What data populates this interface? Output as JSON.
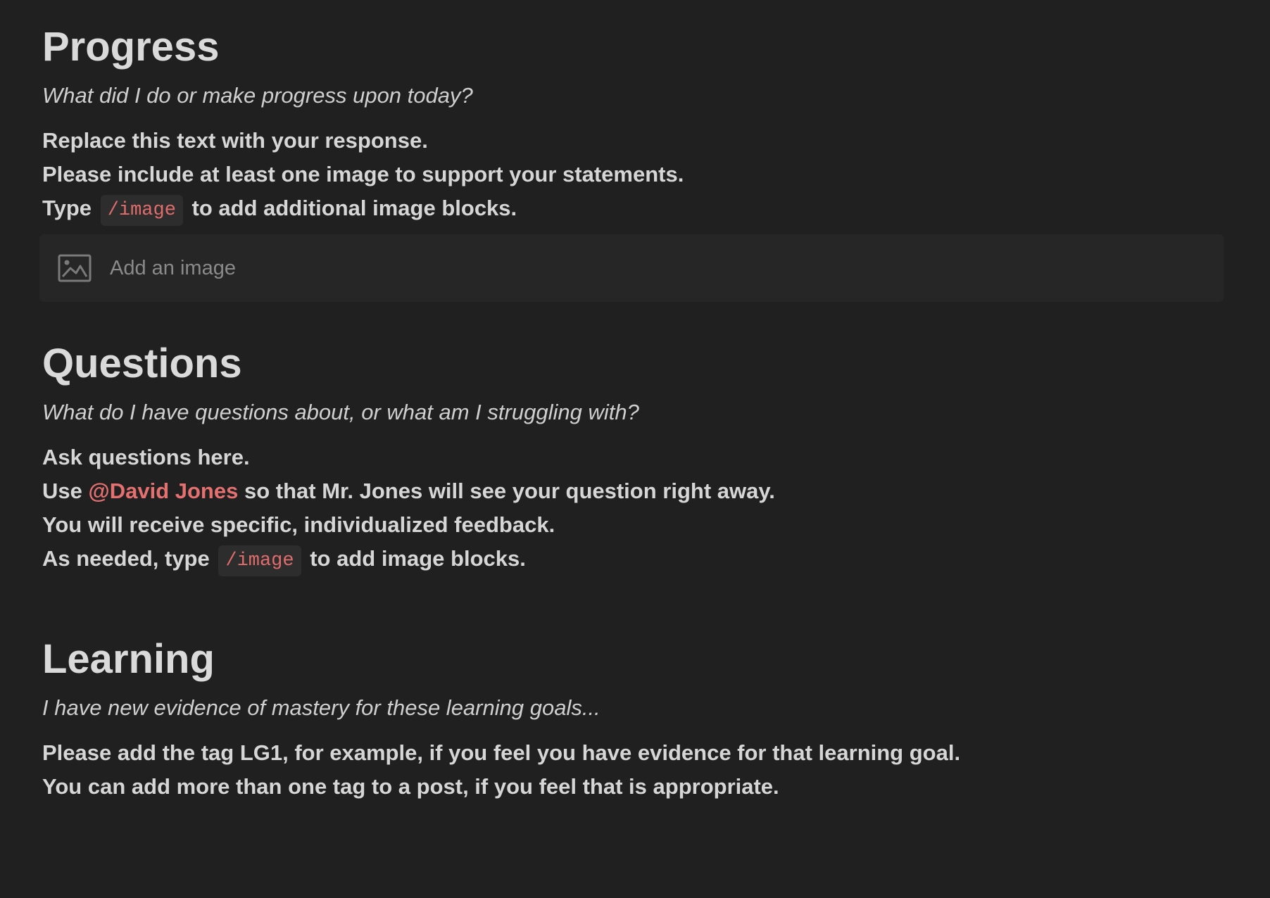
{
  "progress": {
    "heading": "Progress",
    "prompt": "What did I do or make progress upon today?",
    "line1": "Replace this text with your response.",
    "line2": "Please include at least one image to support your statements.",
    "line3_pre": "Type",
    "line3_code": "/image",
    "line3_post": "to add additional image blocks.",
    "image_block_label": "Add an image",
    "image_block_icon": "image-icon"
  },
  "questions": {
    "heading": "Questions",
    "prompt": "What do I have questions about, or what am I struggling with?",
    "line1": "Ask questions here.",
    "line2_pre": "Use",
    "line2_mention": "@David Jones",
    "line2_post": "so that Mr. Jones will see your question right away.",
    "line3": "You will receive specific, individualized feedback.",
    "line4_pre": "As needed, type",
    "line4_code": "/image",
    "line4_post": "to add image blocks."
  },
  "learning": {
    "heading": "Learning",
    "prompt": "I have new evidence of mastery for these learning goals...",
    "line1": "Please add the tag LG1, for example, if you feel you have evidence for that learning goal.",
    "line2": "You can add more than one tag to a post, if you feel that is appropriate."
  },
  "colors": {
    "background": "#202020",
    "text": "#d6d6d6",
    "accent": "#e06c6c",
    "code_bg": "#2d2d2d",
    "image_block_bg": "#262626"
  }
}
